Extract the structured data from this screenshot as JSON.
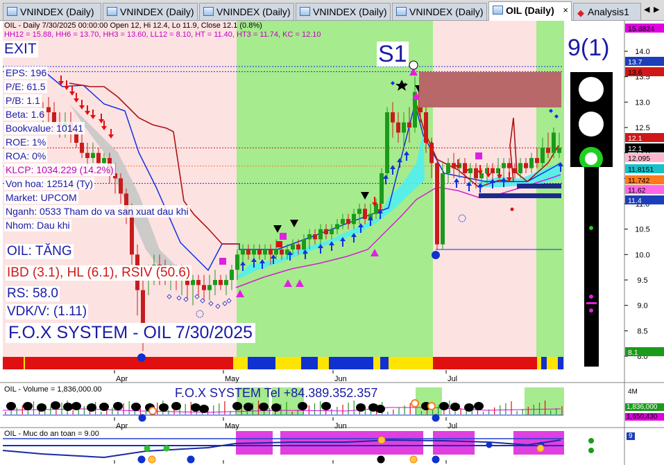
{
  "tabs": [
    {
      "label": "VNINDEX (Daily)",
      "active": false
    },
    {
      "label": "VNINDEX (Daily)",
      "active": false
    },
    {
      "label": "VNINDEX (Daily)",
      "active": false
    },
    {
      "label": "VNINDEX (Daily)",
      "active": false
    },
    {
      "label": "VNINDEX (Daily)",
      "active": false
    },
    {
      "label": "OIL (Daily)",
      "active": true,
      "close": "×"
    },
    {
      "label": "Analysis1",
      "active": false
    }
  ],
  "tab_scroll_left": "◀",
  "tab_scroll_right": "▶",
  "header": {
    "line1": "OIL - Daily 7/30/2025 00:00:00 Open 12, Hi 12.4, Lo 11.9, Close 12.1 (0.8%)",
    "line2": "HH12 = 15.88, HH6 = 13.70, HH3 = 13.60, LL12 = 8.10, HT = 11.40, HT3 = 11.74, KC = 12.10"
  },
  "signals": {
    "exit": "EXIT",
    "s1": "S1",
    "count": "9(1)"
  },
  "fundamentals": [
    {
      "label": "EPS: 196"
    },
    {
      "label": "P/E: 61.5"
    },
    {
      "label": "P/B: 1.1"
    },
    {
      "label": "Beta: 1.6"
    },
    {
      "label": "Bookvalue: 10141"
    },
    {
      "label": "ROE: 1%"
    },
    {
      "label": "ROA: 0%"
    },
    {
      "label": "KLCP: 1034.229 (14.2%)"
    },
    {
      "label": "Von hoa: 12514 (Ty)"
    },
    {
      "label": "Market: UPCOM"
    },
    {
      "label": "Nganh: 0533 Tham do va san xuat dau khi"
    },
    {
      "label": "Nhom: Dau khi"
    }
  ],
  "analysis": {
    "trend": "OIL: TĂNG",
    "ibd": "IBD (3.1), HL (6.1), RSIV (50.6)",
    "rs": "RS: 58.0",
    "vdk": "VDK/V:  (1.11)",
    "brand": "F.O.X SYSTEM - OIL 7/30/2025"
  },
  "volume": {
    "title": "OIL - Volume = 1,836,000.00",
    "brand": "F.O.X SYSTEM Tel +84.389.352.357",
    "axis_label": "4M",
    "tags": [
      {
        "text": "1,836,000",
        "color": "#1a9b1a"
      },
      {
        "text": "1,650,430",
        "color": "#e000e0"
      }
    ]
  },
  "safety": {
    "title": "OIL - Muc do an toan = 9.00",
    "tag": "9"
  },
  "price_axis": {
    "ticks": [
      "14.0",
      "13.5",
      "13.0",
      "12.5",
      "12.0",
      "11.5",
      "11.0",
      "10.5",
      "10.0",
      "9.5",
      "9.0",
      "8.5",
      "8.0"
    ],
    "tags": [
      {
        "text": "15.8824",
        "color": "#e000e0",
        "fg": "#000"
      },
      {
        "text": "13.7",
        "color": "#1c3eb8",
        "fg": "#fff"
      },
      {
        "text": "13.6",
        "color": "#d01818",
        "fg": "#000"
      },
      {
        "text": "12.1",
        "color": "#d01818",
        "fg": "#fff"
      },
      {
        "text": "12.1",
        "color": "#000",
        "fg": "#fff"
      },
      {
        "text": "12.095",
        "color": "#ffb6d0",
        "fg": "#000"
      },
      {
        "text": "11.8151",
        "color": "#18c0c8",
        "fg": "#000"
      },
      {
        "text": "11.742",
        "color": "#ff7a1a",
        "fg": "#000"
      },
      {
        "text": "11.62",
        "color": "#ff66e8",
        "fg": "#000"
      },
      {
        "text": "11.4",
        "color": "#1c3eb8",
        "fg": "#fff"
      },
      {
        "text": "8.1",
        "color": "#1a9b1a",
        "fg": "#fff"
      }
    ]
  },
  "months": [
    "Apr",
    "May",
    "Jun",
    "Jul"
  ],
  "colors": {
    "green_zone": "#a6eb8e",
    "red_zone": "#fde2e2",
    "candle_up": "#1a9b1a",
    "candle_down": "#c81c1c",
    "channel": "#52f0f0",
    "stop_red": "#b01010",
    "stop_blue": "#1030e0",
    "ma_magenta": "#d020d0"
  }
}
